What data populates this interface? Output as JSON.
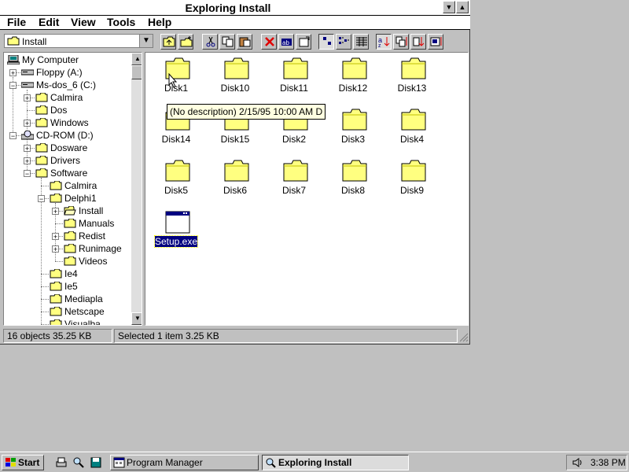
{
  "window": {
    "title": "Exploring Install",
    "menu": [
      "File",
      "Edit",
      "View",
      "Tools",
      "Help"
    ],
    "address": "Install",
    "minimize_glyph": "▼",
    "maximize_glyph": "▲"
  },
  "toolbar": {
    "buttons": [
      "up-folder",
      "new-folder",
      "cut",
      "copy",
      "paste",
      "delete",
      "rename",
      "properties",
      "large-icons",
      "small-icons",
      "list",
      "details",
      "sort-by-name",
      "sort-by-type",
      "sort-by-size",
      "sort-by-date"
    ]
  },
  "tree": {
    "items": [
      {
        "label": "My Computer",
        "icon": "computer-icon"
      },
      {
        "label": "Floppy (A:)",
        "icon": "floppy-drive-icon"
      },
      {
        "label": "Ms-dos_6 (C:)",
        "icon": "hard-drive-icon"
      },
      {
        "label": "Calmira",
        "icon": "folder-icon"
      },
      {
        "label": "Dos",
        "icon": "folder-icon"
      },
      {
        "label": "Windows",
        "icon": "folder-icon"
      },
      {
        "label": "CD-ROM (D:)",
        "icon": "cdrom-drive-icon"
      },
      {
        "label": "Dosware",
        "icon": "folder-icon"
      },
      {
        "label": "Drivers",
        "icon": "folder-icon"
      },
      {
        "label": "Software",
        "icon": "folder-icon"
      },
      {
        "label": "Calmira",
        "icon": "folder-icon"
      },
      {
        "label": "Delphi1",
        "icon": "folder-icon"
      },
      {
        "label": "Install",
        "icon": "open-folder-icon"
      },
      {
        "label": "Manuals",
        "icon": "folder-icon"
      },
      {
        "label": "Redist",
        "icon": "folder-icon"
      },
      {
        "label": "Runimage",
        "icon": "folder-icon"
      },
      {
        "label": "Videos",
        "icon": "folder-icon"
      },
      {
        "label": "Ie4",
        "icon": "folder-icon"
      },
      {
        "label": "Ie5",
        "icon": "folder-icon"
      },
      {
        "label": "Mediapla",
        "icon": "folder-icon"
      },
      {
        "label": "Netscape",
        "icon": "folder-icon"
      },
      {
        "label": "Visualba",
        "icon": "folder-icon"
      }
    ],
    "expand_glyphs": {
      "plus": "+",
      "minus": "−"
    }
  },
  "files": {
    "items": [
      {
        "label": "Disk1",
        "icon": "folder-icon"
      },
      {
        "label": "Disk10",
        "icon": "folder-icon"
      },
      {
        "label": "Disk11",
        "icon": "folder-icon"
      },
      {
        "label": "Disk12",
        "icon": "folder-icon"
      },
      {
        "label": "Disk13",
        "icon": "folder-icon"
      },
      {
        "label": "Disk14",
        "icon": "folder-icon"
      },
      {
        "label": "Disk15",
        "icon": "folder-icon"
      },
      {
        "label": "Disk2",
        "icon": "folder-icon"
      },
      {
        "label": "Disk3",
        "icon": "folder-icon"
      },
      {
        "label": "Disk4",
        "icon": "folder-icon"
      },
      {
        "label": "Disk5",
        "icon": "folder-icon"
      },
      {
        "label": "Disk6",
        "icon": "folder-icon"
      },
      {
        "label": "Disk7",
        "icon": "folder-icon"
      },
      {
        "label": "Disk8",
        "icon": "folder-icon"
      },
      {
        "label": "Disk9",
        "icon": "folder-icon"
      },
      {
        "label": "Setup.exe",
        "icon": "application-icon",
        "selected": true
      }
    ],
    "tooltip": "(No description)  2/15/95  10:00 AM  D"
  },
  "status": {
    "objects": "16 objects  35.25 KB",
    "selected": "Selected 1 item  3.25 KB"
  },
  "taskbar": {
    "start": "Start",
    "tasks": [
      {
        "label": "Program Manager",
        "active": false
      },
      {
        "label": "Exploring Install",
        "active": true
      }
    ],
    "clock": "3:38 PM"
  },
  "colors": {
    "desktop": "#c0c0c0",
    "folder": "#ffff80",
    "selection": "#000080",
    "tooltip_bg": "#ffffe1"
  }
}
